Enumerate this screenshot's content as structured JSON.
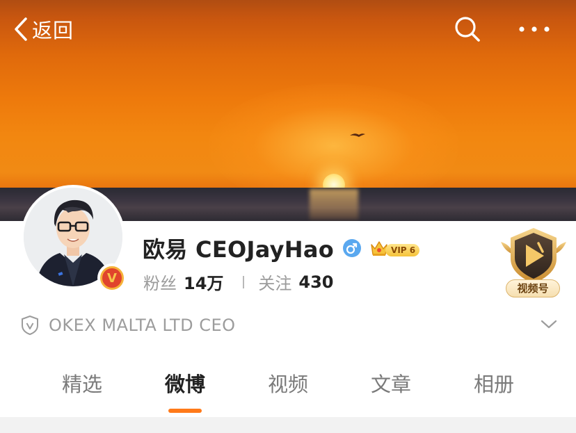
{
  "nav": {
    "back_label": "返回",
    "search_icon": "search-icon",
    "more_icon": "more-dots-icon"
  },
  "cover": {
    "scene": "sunset-over-sea"
  },
  "profile": {
    "username": "欧易 CEOJayHao",
    "gender": "male",
    "verified_badge_letter": "V",
    "vip_label": "VIP 6",
    "followers_label": "粉丝",
    "followers_value": "14万",
    "following_label": "关注",
    "following_value": "430",
    "channel_label": "视频号"
  },
  "company": {
    "text": "OKEX MALTA LTD CEO",
    "icon": "shield-v-icon",
    "expand_icon": "chevron-down-icon"
  },
  "tabs": [
    {
      "label": "精选",
      "active": false
    },
    {
      "label": "微博",
      "active": true
    },
    {
      "label": "视频",
      "active": false
    },
    {
      "label": "文章",
      "active": false
    },
    {
      "label": "相册",
      "active": false
    }
  ],
  "colors": {
    "accent": "#ff7a1a",
    "text_primary": "#222222",
    "text_secondary": "#9b9b9b",
    "gender_blue": "#4a9ff0",
    "vip_gold": "#f5c23a",
    "verify_red": "#e0442c"
  }
}
